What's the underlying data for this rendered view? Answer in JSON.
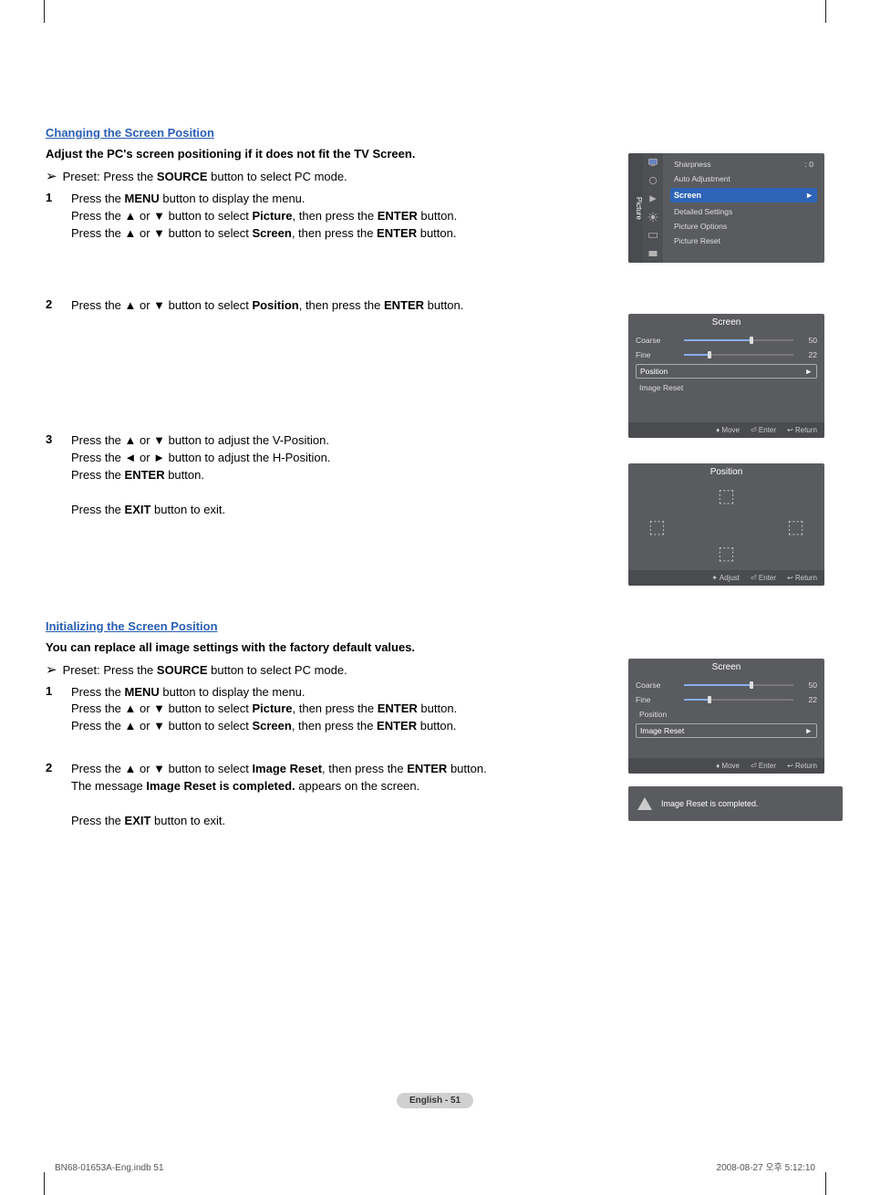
{
  "section1": {
    "heading": "Changing the Screen Position",
    "subheading": "Adjust the PC's screen positioning if it does not fit the TV Screen.",
    "preset_prefix": "Preset: Press the ",
    "preset_btn": "SOURCE",
    "preset_suffix": " button to select PC mode.",
    "step1_a": "Press the ",
    "step1_menu": "MENU",
    "step1_b": " button to display the menu.",
    "step1_line2a": "Press the ▲ or ▼ button to select ",
    "step1_picture": "Picture",
    "step1_line2b": ", then press the ",
    "step1_enter": "ENTER",
    "step1_line2c": " button.",
    "step1_line3a": "Press the ▲ or ▼ button to select ",
    "step1_screen": "Screen",
    "step1_line3b": ", then press the ",
    "step1_line3c": " button.",
    "step2_a": "Press the ▲ or ▼ button to select ",
    "step2_pos": "Position",
    "step2_b": ", then press the ",
    "step2_c": " button.",
    "step3_a": "Press the ▲ or ▼ button to adjust the V-Position.",
    "step3_b": "Press the ◄ or ► button to adjust the H-Position.",
    "step3_c1": "Press the ",
    "step3_c2": " button.",
    "step3_d1": "Press the ",
    "step3_exit": "EXIT",
    "step3_d2": " button to exit."
  },
  "osd_picture": {
    "tab": "Picture",
    "sharpness": "Sharpness",
    "sharpness_val": ": 0",
    "auto": "Auto Adjustment",
    "screen": "Screen",
    "detailed": "Detailed Settings",
    "options": "Picture Options",
    "reset": "Picture Reset"
  },
  "osd_screen": {
    "title": "Screen",
    "coarse": "Coarse",
    "coarse_val": "50",
    "fine": "Fine",
    "fine_val": "22",
    "position": "Position",
    "image_reset": "Image Reset",
    "foot_move": "Move",
    "foot_enter": "Enter",
    "foot_return": "Return"
  },
  "osd_position": {
    "title": "Position",
    "foot_adjust": "Adjust",
    "foot_enter": "Enter",
    "foot_return": "Return"
  },
  "section2": {
    "heading": "Initializing the Screen Position",
    "subheading": "You can replace all image settings with the factory default values.",
    "step2_a": "Press the ▲ or ▼ button to select ",
    "step2_ir": "Image Reset",
    "step2_b": ", then press the ",
    "step2_c": " button.",
    "step2_msg1": "The message ",
    "step2_msg_bold": "Image Reset is completed.",
    "step2_msg2": " appears on the screen."
  },
  "toast": "Image Reset is completed.",
  "page_label": "English - 51",
  "footer_left": "BN68-01653A-Eng.indb   51",
  "footer_right": "2008-08-27   오후 5:12:10",
  "chart_data": {
    "type": "table",
    "sliders": [
      {
        "name": "Coarse",
        "value": 50,
        "percent": 60
      },
      {
        "name": "Fine",
        "value": 22,
        "percent": 22
      }
    ]
  }
}
